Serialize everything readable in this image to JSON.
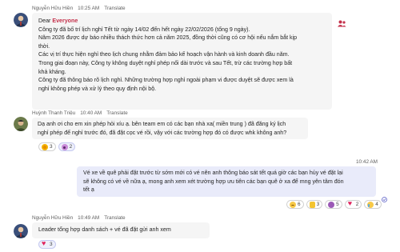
{
  "messages": [
    {
      "sender": "Nguyễn Hữu Hiền",
      "time": "10:25 AM",
      "translate": "Translate",
      "greeting_prefix": "Dear ",
      "mention": "Everyone",
      "lines": [
        "Công ty đã bố trí lịch nghỉ Tết từ ngày 14/02 đến hết ngày 22/02/2026 (tổng 9 ngày).",
        "Năm 2026 được dự báo nhiều thách thức hơn cả năm 2025, đồng thời cũng có cơ hội nếu nắm bắt kịp",
        "thời.",
        "Các vị trí thực hiện nghỉ theo lịch chung nhằm đảm bảo kế hoạch vận hành và kinh doanh đầu năm.",
        "Trong giai đoạn này, Công ty không duyệt nghỉ phép nối dài trước và sau Tết, trừ các trường hợp bất",
        "khả kháng.",
        "Công ty đã thông báo rõ lịch nghỉ. Những trường hợp nghỉ ngoài phạm vi được duyệt sẽ được xem là",
        "nghỉ không phép và xử lý theo quy định nội bộ."
      ],
      "side_icon": "group-mention-icon"
    },
    {
      "sender": "Huỳnh Thanh Triệu",
      "time": "10:40 AM",
      "translate": "Translate",
      "lines": [
        "Dạ anh ơi cho em xin phép hỏi xíu ạ. bên team em có các bạn nhà xa( miền trung ) đã đăng ký lịch",
        "nghỉ phép để nghỉ trước đó, đã đặt cọc vé rồi, vậy với các trường hợp đó có được whk không anh?"
      ],
      "reactions": [
        {
          "icon": "clap-icon",
          "count": "3"
        },
        {
          "icon": "surprised-icon",
          "count": "2"
        }
      ]
    },
    {
      "time": "10:42 AM",
      "lines": [
        "Vé xe về quê phải đặt trước từ sớm mới có vé nên anh thông báo sát tết quá giờ các bạn hủy vé đặt lại",
        "sẽ không có vé về nữa ạ, mong anh xem xét trường hợp ưu tiên các bạn quê ở xa để mng yên tâm đón",
        "tết ạ"
      ],
      "reactions": [
        {
          "icon": "sad-icon",
          "count": "6"
        },
        {
          "icon": "thumbs-up-icon",
          "count": "3"
        },
        {
          "icon": "surprised-icon",
          "count": "5"
        },
        {
          "icon": "heart-icon",
          "count": "2"
        },
        {
          "icon": "crying-icon",
          "count": "4"
        }
      ],
      "status_icon": "seen-icon"
    },
    {
      "sender": "Nguyễn Hữu Hiền",
      "time": "10:49 AM",
      "translate": "Translate",
      "lines": [
        "Leader tổng hợp danh sách + vé đã đặt gửi anh xem"
      ],
      "reactions": [
        {
          "icon": "heart-icon",
          "count": "3"
        }
      ]
    }
  ]
}
